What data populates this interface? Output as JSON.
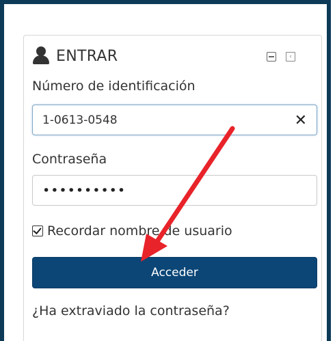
{
  "panel": {
    "title": "ENTRAR",
    "icon": "user-icon",
    "header_icons": [
      "collapse-icon",
      "dock-icon"
    ]
  },
  "form": {
    "id_label": "Número de identificación",
    "id_value": "1-0613-0548",
    "password_label": "Contraseña",
    "password_value": "••••••••••",
    "remember_label": "Recordar nombre de usuario",
    "remember_checked": true,
    "submit_label": "Acceder",
    "forgot_link": "¿Ha extraviado la contraseña?"
  },
  "annotation": {
    "arrow_color": "#e8232a"
  },
  "colors": {
    "frame": "#0d3a57",
    "button": "#0b4677"
  }
}
